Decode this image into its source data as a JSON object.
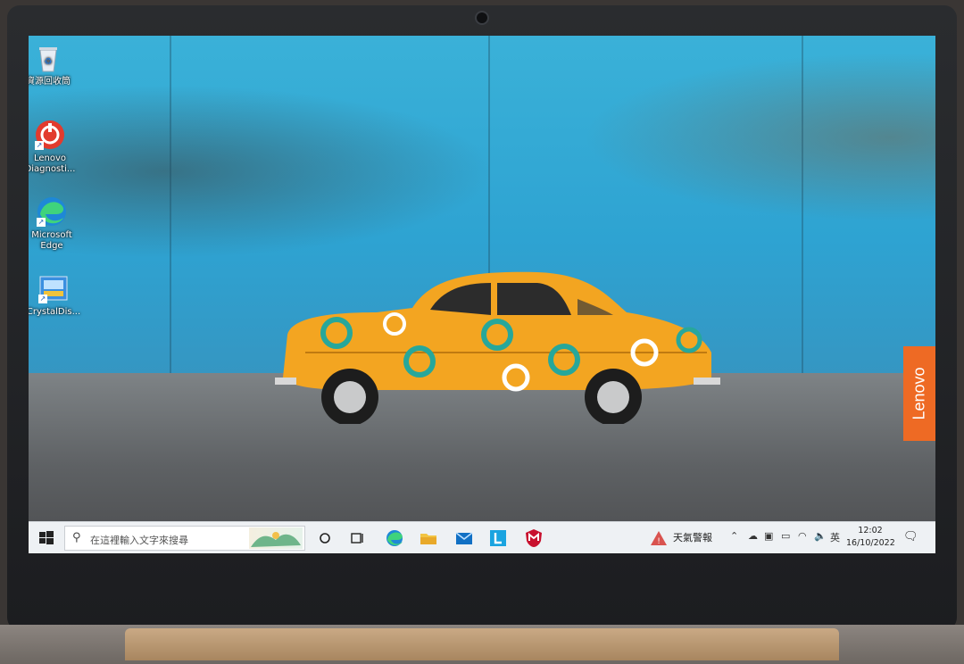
{
  "desktop": {
    "icons": [
      {
        "label": "資源回收筒",
        "icon": "recycle-bin-icon"
      },
      {
        "label": "Lenovo Diagnosti...",
        "icon": "lenovo-diagnostics-icon"
      },
      {
        "label": "Microsoft Edge",
        "icon": "edge-icon"
      },
      {
        "label": "CrystalDis...",
        "icon": "crystaldisk-icon"
      }
    ],
    "brand_tab": "Lenovo"
  },
  "taskbar": {
    "search_placeholder": "在這裡輸入文字來搜尋",
    "weather_label": "天氣警報",
    "ime_label": "英",
    "clock_time": "12:02",
    "clock_date": "16/10/2022"
  },
  "colors": {
    "wall": "#2ea3d2",
    "car": "#f3a521",
    "lenovo_orange": "#ee6a24",
    "taskbar": "#eef1f4"
  }
}
